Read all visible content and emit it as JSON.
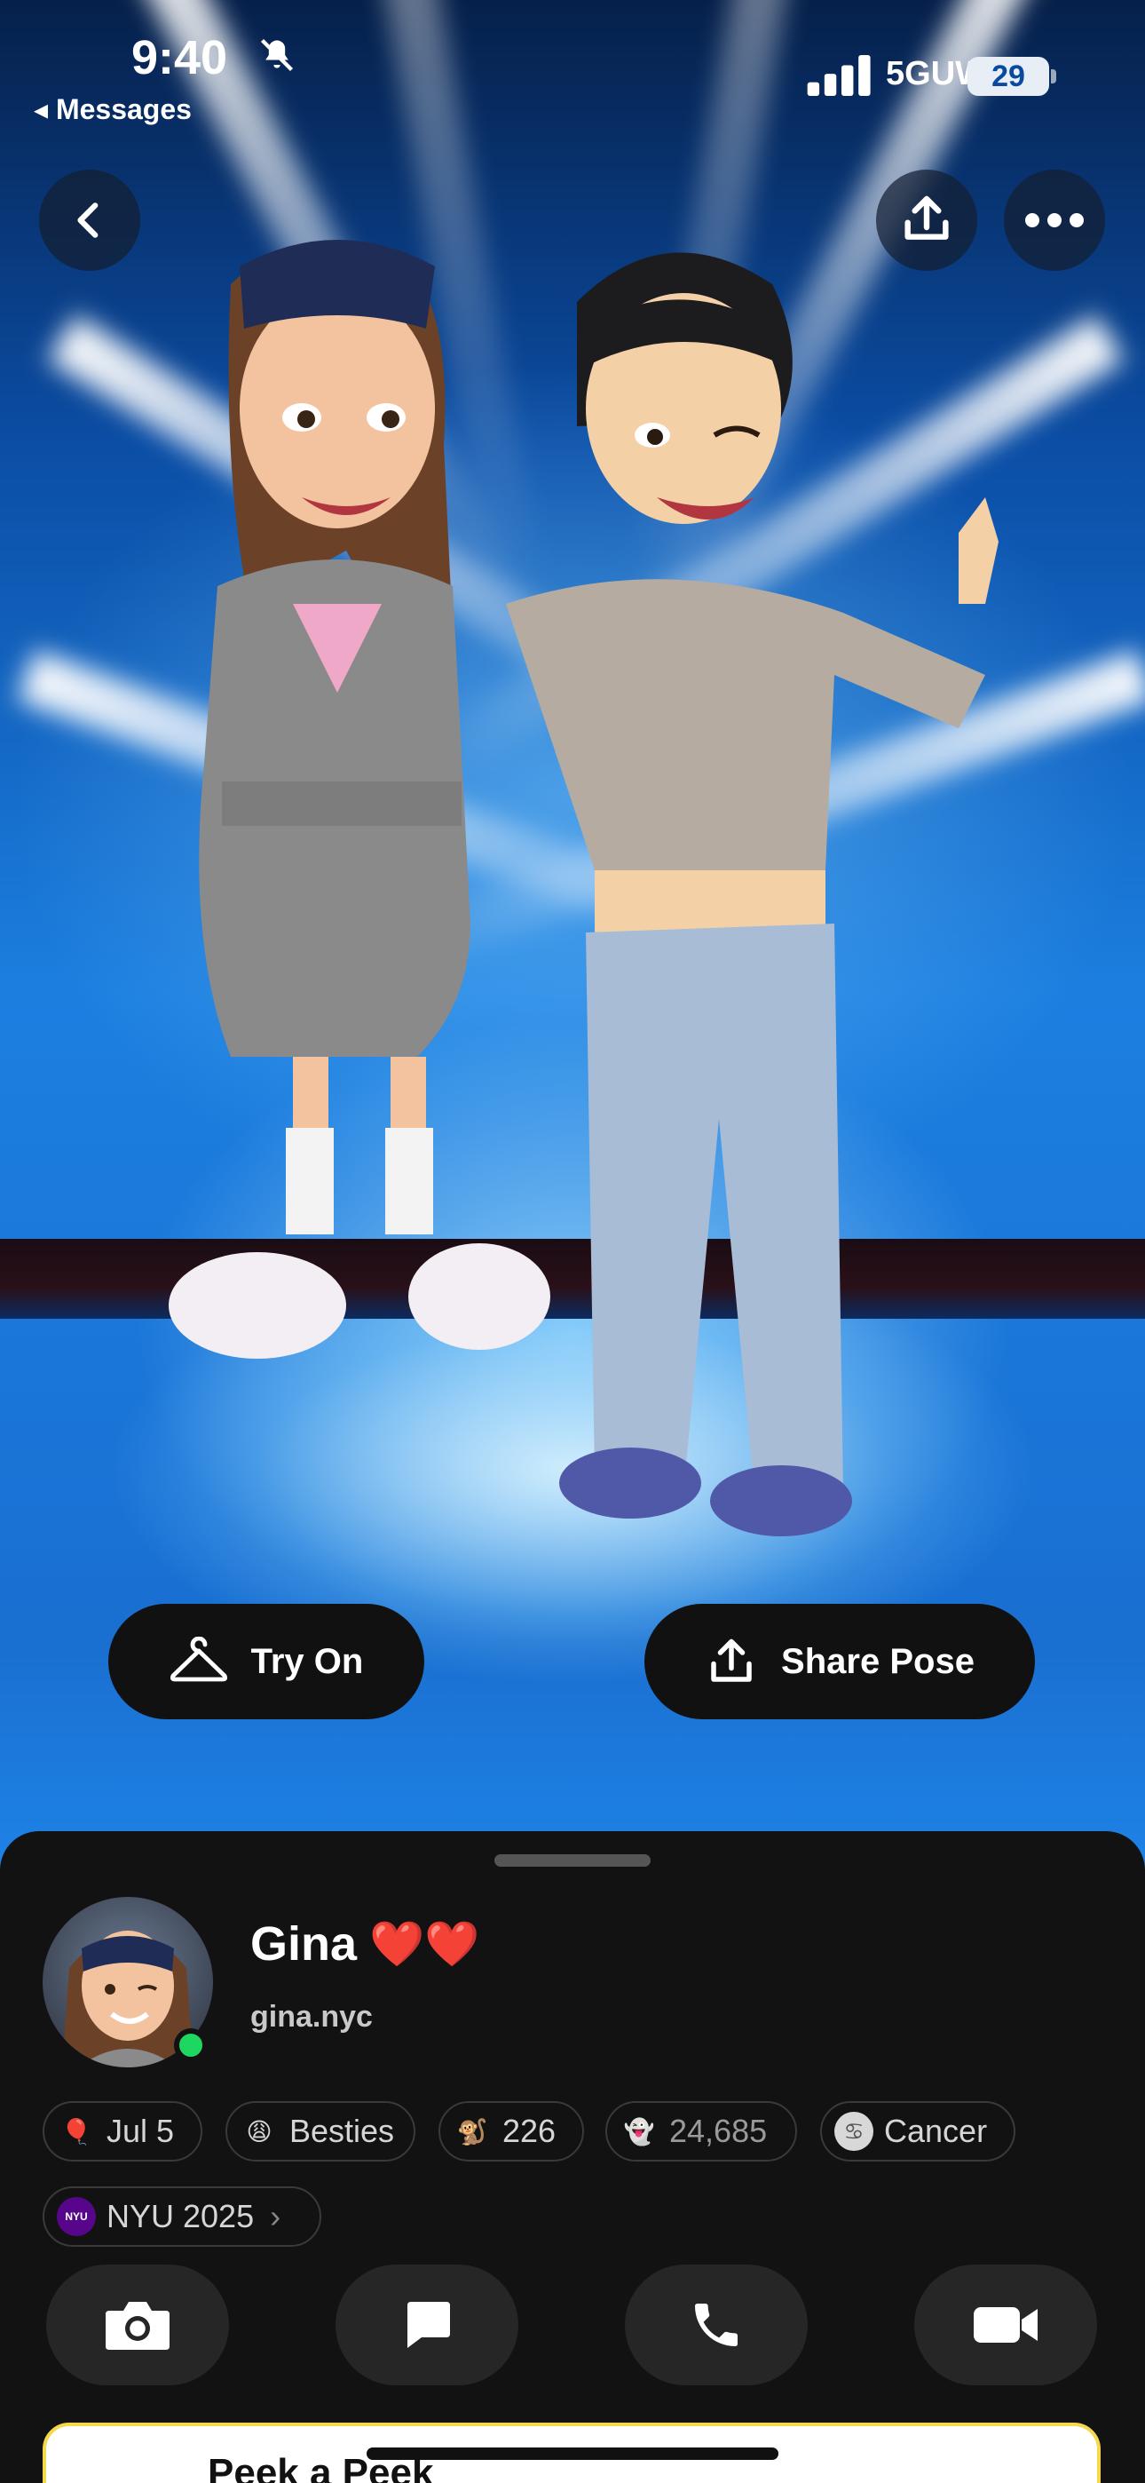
{
  "status_bar": {
    "time": "9:40",
    "back_app_label": "◂ Messages",
    "network": "5GUW",
    "battery": "29"
  },
  "top_actions": {
    "back_icon": "chevron-left-icon",
    "share_icon": "upload-icon",
    "more_icon": "ellipsis-icon"
  },
  "buttons": {
    "try_on": "Try On",
    "share_pose": "Share Pose"
  },
  "profile": {
    "name": "Gina",
    "name_emoji": "❤️❤️",
    "username": "gina.nyc",
    "online": true
  },
  "chips": [
    {
      "icon": "🎈",
      "label": "Jul 5"
    },
    {
      "icon": "😩",
      "label": "Besties"
    },
    {
      "icon": "🐒",
      "label": "226"
    },
    {
      "icon": "👻",
      "label": "24,685"
    },
    {
      "icon": "♋",
      "label": "Cancer"
    },
    {
      "icon": "NYU",
      "label": "NYU 2025",
      "chevron": "›"
    }
  ],
  "actions": [
    {
      "icon": "camera-icon"
    },
    {
      "icon": "chat-icon"
    },
    {
      "icon": "phone-icon"
    },
    {
      "icon": "video-icon"
    }
  ],
  "peek": {
    "label": "Peek a Peek"
  },
  "colors": {
    "sheet_bg": "#121212",
    "online": "#1ed760",
    "peek_border": "#f4d94a",
    "sky": "#1c7fe0"
  }
}
